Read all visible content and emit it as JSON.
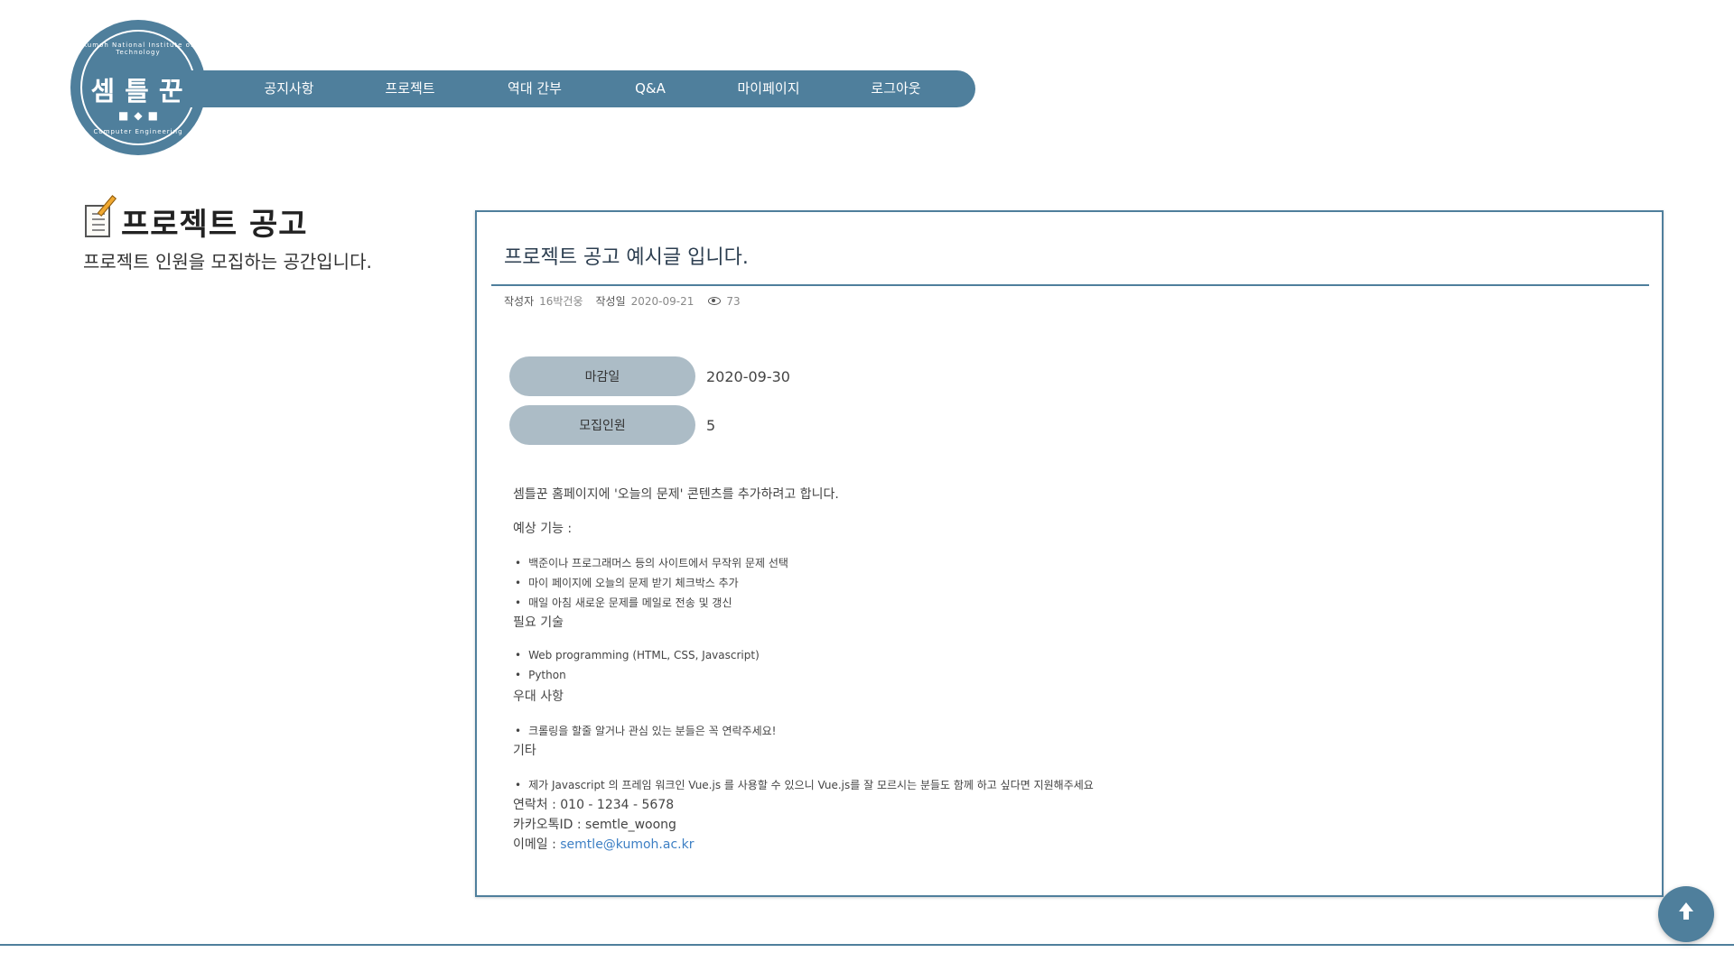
{
  "logo": {
    "text": "셈틀꾼",
    "arc_top": "Kumoh National Institute of Technology",
    "arc_bottom": "Computer Engineering",
    "marks": "■◆■"
  },
  "nav": {
    "items": [
      {
        "label": "공지사항"
      },
      {
        "label": "프로젝트"
      },
      {
        "label": "역대 간부"
      },
      {
        "label": "Q&A"
      },
      {
        "label": "마이페이지"
      },
      {
        "label": "로그아웃"
      }
    ]
  },
  "page": {
    "title": "프로젝트 공고",
    "subtitle": "프로젝트 인원을 모집하는 공간입니다.",
    "icon": "memo-icon"
  },
  "post": {
    "title": "프로젝트 공고 예시글 입니다.",
    "meta": {
      "author_label": "작성자",
      "author": "16박건웅",
      "date_label": "작성일",
      "date": "2020-09-21",
      "views": "73"
    },
    "deadline": {
      "label": "마감일",
      "value": "2020-09-30"
    },
    "recruit": {
      "label": "모집인원",
      "value": "5"
    },
    "body": {
      "intro": "셈틀꾼 홈페이지에 '오늘의 문제' 콘텐츠를 추가하려고 합니다.",
      "features_heading": "예상 기능 :",
      "features": [
        "백준이나 프로그래머스 등의 사이트에서 무작위 문제 선택",
        "마이 페이지에 오늘의 문제 받기 체크박스 추가",
        "매일 아침 새로운 문제를 메일로 전송 및 갱신"
      ],
      "skills_heading": "필요 기술",
      "skills": [
        "Web programming (HTML, CSS, Javascript)",
        "Python"
      ],
      "preferred_heading": "우대 사항",
      "preferred": [
        "크롤링을 할줄 알거나 관심 있는 분들은 꼭 연락주세요!"
      ],
      "etc_heading": "기타",
      "etc": [
        "제가 Javascript 의 프레임 워크인 Vue.js 를 사용할 수 있으니 Vue.js를 잘 모르시는 분들도 함께 하고 싶다면 지원해주세요"
      ],
      "contact": "연락처 : 010 - 1234 - 5678",
      "kakao": "카카오톡ID : semtle_woong",
      "email_label": "이메일 : ",
      "email": "semtle@kumoh.ac.kr"
    }
  },
  "colors": {
    "primary": "#4f7f9c",
    "pill": "#acbcc6",
    "link": "#3d7fc4"
  }
}
